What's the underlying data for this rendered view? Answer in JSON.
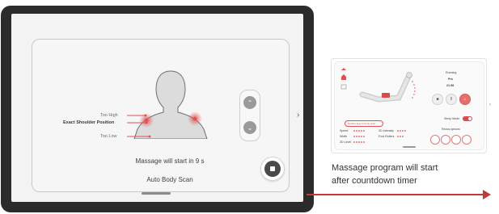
{
  "main_screen": {
    "labels": {
      "too_high": "Too High",
      "exact_shoulder_position": "Exact Shoulder Position",
      "too_low": "Too Low"
    },
    "status": "Massage will start in 9 s",
    "mode": "Auto Body Scan",
    "icons": [
      "chevron-up-icon",
      "chevron-down-icon",
      "stop-icon",
      "chevron-right-icon"
    ],
    "colors": {
      "accent": "#e05050",
      "bezel": "#2b2b2b"
    }
  },
  "thumbnail": {
    "status_title": "Running",
    "program_name": "Pro",
    "timer": "21:58",
    "pill_label": "Decline legs to body scan",
    "settings": [
      {
        "label": "Speed"
      },
      {
        "label": "Width"
      },
      {
        "label": "3D Level"
      },
      {
        "label": "3D Intensity"
      },
      {
        "label": "Foot Rollers"
      }
    ],
    "sleep_mode_label": "Sleep Mode",
    "recs_label": "Recos options"
  },
  "caption": {
    "line1": "Massage program will start",
    "line2": "after countdown timer"
  }
}
